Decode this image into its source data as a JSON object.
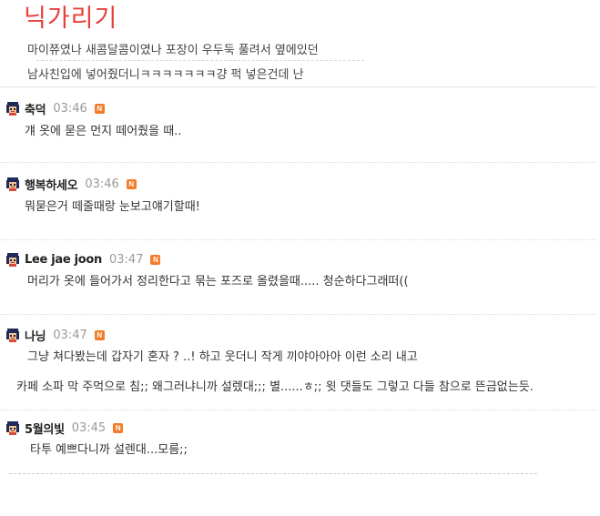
{
  "post": {
    "title": "닉가리기",
    "lines": [
      "마이쮸였나 새콤달콤이였나 포장이 우두둑 풀려서 옆에있던",
      "남사친입에 넣어줬더니ㅋㅋㅋㅋㅋㅋㅋ걍 퍽 넣은건데 난"
    ]
  },
  "badge_label": "N",
  "comments": [
    {
      "nick": "축덕",
      "time": "03:46",
      "body": [
        "걔 옷에 묻은 먼지 떼어줬을 때.."
      ]
    },
    {
      "nick": "행복하세오",
      "time": "03:46",
      "body": [
        "뭐묻은거 떼줄때랑 눈보고얘기할때!"
      ]
    },
    {
      "nick": "Lee jae joon",
      "time": "03:47",
      "body": [
        "머리가 옷에 들어가서 정리한다고 묶는 포즈로 올렸을때..... 청순하다그래떠(("
      ]
    },
    {
      "nick": "나닝",
      "time": "03:47",
      "body": [
        "그냥 쳐다봤는데 갑자기 혼자 ? ..! 하고 웃더니 작게 끼야아아아 이런 소리 내고",
        "카페 소파 막 주먹으로 침;; 왜그러냐니까 설렜대;;; 별......ㅎ;; 윗 댓들도 그렇고 다들 참으로 뜬금없는듯."
      ]
    },
    {
      "nick": "5월의빛",
      "time": "03:45",
      "body": [
        "타투 예쁘다니까 설렌대...모름;;"
      ]
    }
  ],
  "colors": {
    "title": "#e8403b",
    "badge": "#f37b2a",
    "time": "#999999"
  },
  "icons": {
    "avatar": "pixel-character-avatar-icon",
    "new": "new-badge-icon"
  }
}
